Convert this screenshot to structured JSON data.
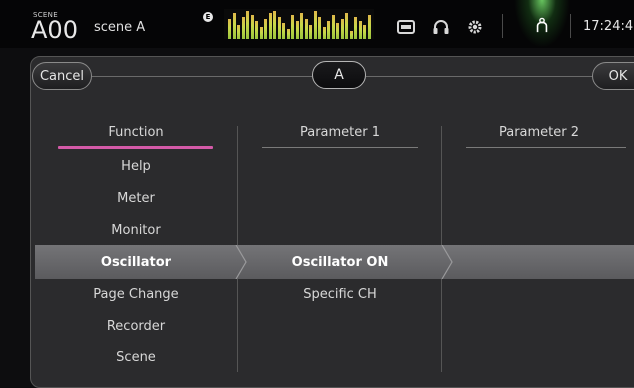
{
  "status_bar": {
    "scene_caption": "SCENE",
    "scene_number": "A00",
    "scene_name": "scene A",
    "edit_badge": "E",
    "time": "17:24:4",
    "icons": [
      "recorder-icon",
      "headphones-icon",
      "gear-icon",
      "user-icon"
    ]
  },
  "dialog": {
    "cancel_label": "Cancel",
    "ok_label": "OK",
    "key_label": "A"
  },
  "columns": {
    "function_header": "Function",
    "param1_header": "Parameter 1",
    "param2_header": "Parameter 2"
  },
  "function_items": [
    "Help",
    "Meter",
    "Monitor",
    "Oscillator",
    "Page Change",
    "Recorder",
    "Scene"
  ],
  "selected_function": "Oscillator",
  "param1_items": [
    "Oscillator ON",
    "Specific CH"
  ],
  "selected_param1": "Oscillator ON",
  "colors": {
    "accent_pink": "#d45aa8",
    "selection_row": "#69696c"
  }
}
